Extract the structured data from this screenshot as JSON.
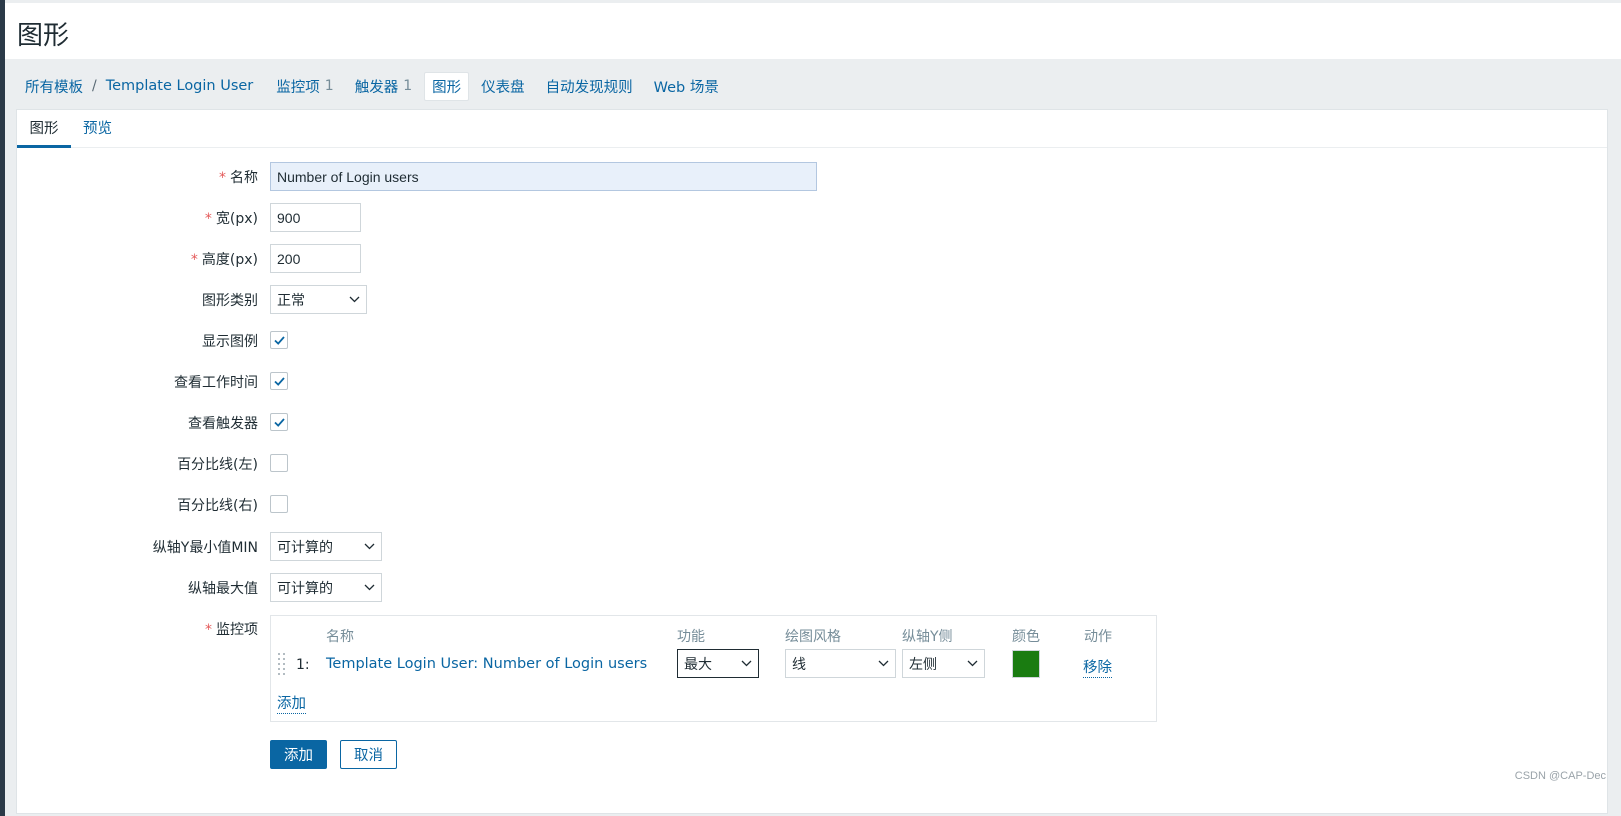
{
  "page": {
    "title": "图形"
  },
  "breadcrumbs": {
    "all_templates": "所有模板",
    "separator": "/",
    "template": "Template Login User",
    "items_label": "监控项",
    "items_count": "1",
    "triggers_label": "触发器",
    "triggers_count": "1",
    "graphs_label": "图形",
    "dashboards_label": "仪表盘",
    "discovery_label": "自动发现规则",
    "web_label": "Web 场景"
  },
  "tabs": {
    "graph": "图形",
    "preview": "预览"
  },
  "form": {
    "name_label": "名称",
    "name_value": "Number of Login users",
    "width_label": "宽(px)",
    "width_value": "900",
    "height_label": "高度(px)",
    "height_value": "200",
    "graph_type_label": "图形类别",
    "graph_type_value": "正常",
    "show_legend_label": "显示图例",
    "show_legend_checked": true,
    "show_working_time_label": "查看工作时间",
    "show_working_time_checked": true,
    "show_triggers_label": "查看触发器",
    "show_triggers_checked": true,
    "percentile_left_label": "百分比线(左)",
    "percentile_left_checked": false,
    "percentile_right_label": "百分比线(右)",
    "percentile_right_checked": false,
    "ymin_label": "纵轴Y最小值MIN",
    "ymin_value": "可计算的",
    "ymax_label": "纵轴最大值",
    "ymax_value": "可计算的",
    "items_label": "监控项"
  },
  "items_table": {
    "headers": {
      "name": "名称",
      "function": "功能",
      "draw_style": "绘图风格",
      "y_axis_side": "纵轴Y侧",
      "color": "颜色",
      "action": "动作"
    },
    "rows": [
      {
        "index": "1:",
        "name": "Template Login User: Number of Login users",
        "function": "最大",
        "draw_style": "线",
        "y_axis_side": "左侧",
        "color": "#1a7c11",
        "action": "移除"
      }
    ],
    "add_link": "添加"
  },
  "buttons": {
    "add": "添加",
    "cancel": "取消"
  },
  "watermark": "CSDN @CAP-Dec",
  "colors": {
    "accent": "#0a66a3",
    "required": "#e45959",
    "item_color": "#1a7c11"
  }
}
